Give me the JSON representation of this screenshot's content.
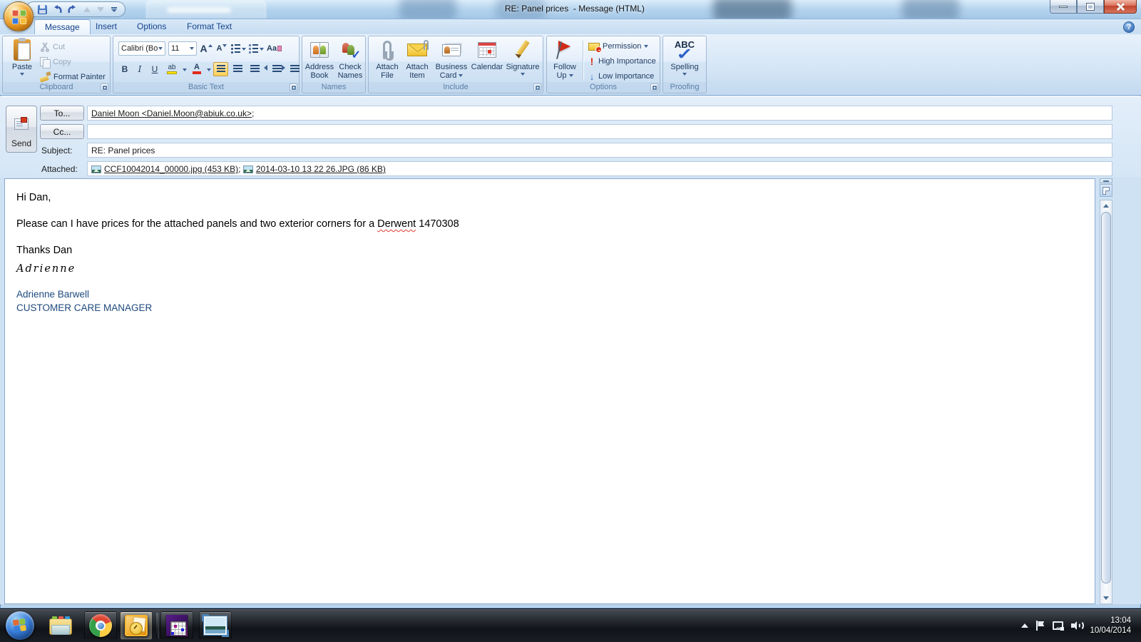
{
  "titlebar": {
    "title": "RE: Panel prices  - Message (HTML)"
  },
  "tabs": {
    "items": [
      {
        "label": "Message",
        "active": true
      },
      {
        "label": "Insert",
        "active": false
      },
      {
        "label": "Options",
        "active": false
      },
      {
        "label": "Format Text",
        "active": false
      }
    ],
    "help_glyph": "?"
  },
  "ribbon": {
    "clipboard": {
      "label": "Clipboard",
      "paste": "Paste",
      "cut": "Cut",
      "copy": "Copy",
      "format_painter": "Format Painter"
    },
    "basic_text": {
      "label": "Basic Text",
      "font_name": "Calibri (Bo",
      "font_size": "11",
      "grow": "A",
      "shrink": "A",
      "bold": "B",
      "italic": "I",
      "underline": "U",
      "highlight": "ab",
      "font_color": "A",
      "clear": "Aa"
    },
    "names": {
      "label": "Names",
      "address_book_1": "Address",
      "address_book_2": "Book",
      "check_names_1": "Check",
      "check_names_2": "Names",
      "check_glyph": "✓"
    },
    "include": {
      "label": "Include",
      "attach_file_1": "Attach",
      "attach_file_2": "File",
      "attach_item_1": "Attach",
      "attach_item_2": "Item",
      "business_card_1": "Business",
      "business_card_2": "Card",
      "calendar": "Calendar",
      "signature": "Signature"
    },
    "options": {
      "label": "Options",
      "follow_up_1": "Follow",
      "follow_up_2": "Up",
      "permission": "Permission",
      "high_importance": "High Importance",
      "low_importance": "Low Importance",
      "high_glyph": "!",
      "low_glyph": "↓"
    },
    "proofing": {
      "label": "Proofing",
      "spelling": "Spelling",
      "abc_glyph": "ABC",
      "check_glyph": "✓"
    }
  },
  "form": {
    "send_label": "Send",
    "to_button": "To...",
    "cc_button": "Cc...",
    "subject_label": "Subject:",
    "attached_label": "Attached:",
    "to_value": "Daniel Moon <Daniel.Moon@abiuk.co.uk>",
    "to_sep": ";",
    "cc_value": "",
    "subject_value": "RE: Panel prices",
    "attachments": [
      {
        "label": "CCF10042014_00000.jpg (453 KB)",
        "sep": "; "
      },
      {
        "label": "2014-03-10 13 22 26.JPG (86 KB)",
        "sep": ""
      }
    ]
  },
  "body": {
    "greeting": "Hi Dan,",
    "request_pre": "Please can I have prices for the attached panels and two exterior corners for a ",
    "request_word": "Derwent",
    "request_post": " 1470308",
    "thanks": "Thanks Dan",
    "signature_script": "Adrienne",
    "signature_name": "Adrienne Barwell",
    "signature_role": "CUSTOMER CARE MANAGER"
  },
  "taskbar": {
    "time": "13:04",
    "date": "10/04/2014"
  },
  "colors": {
    "title_glass": "#b9d7ef",
    "ribbon_bg": "#d3e5f6",
    "active_highlight": "#ffd159",
    "group_label_text": "#5a7ea8",
    "signature_blue": "#1f497d",
    "script_blue": "#8095b5",
    "squiggle_red": "#e03c31",
    "taskbar_dark": "#1d2126",
    "close_red": "#c0442c",
    "outlook_orange": "#f0a51f"
  }
}
